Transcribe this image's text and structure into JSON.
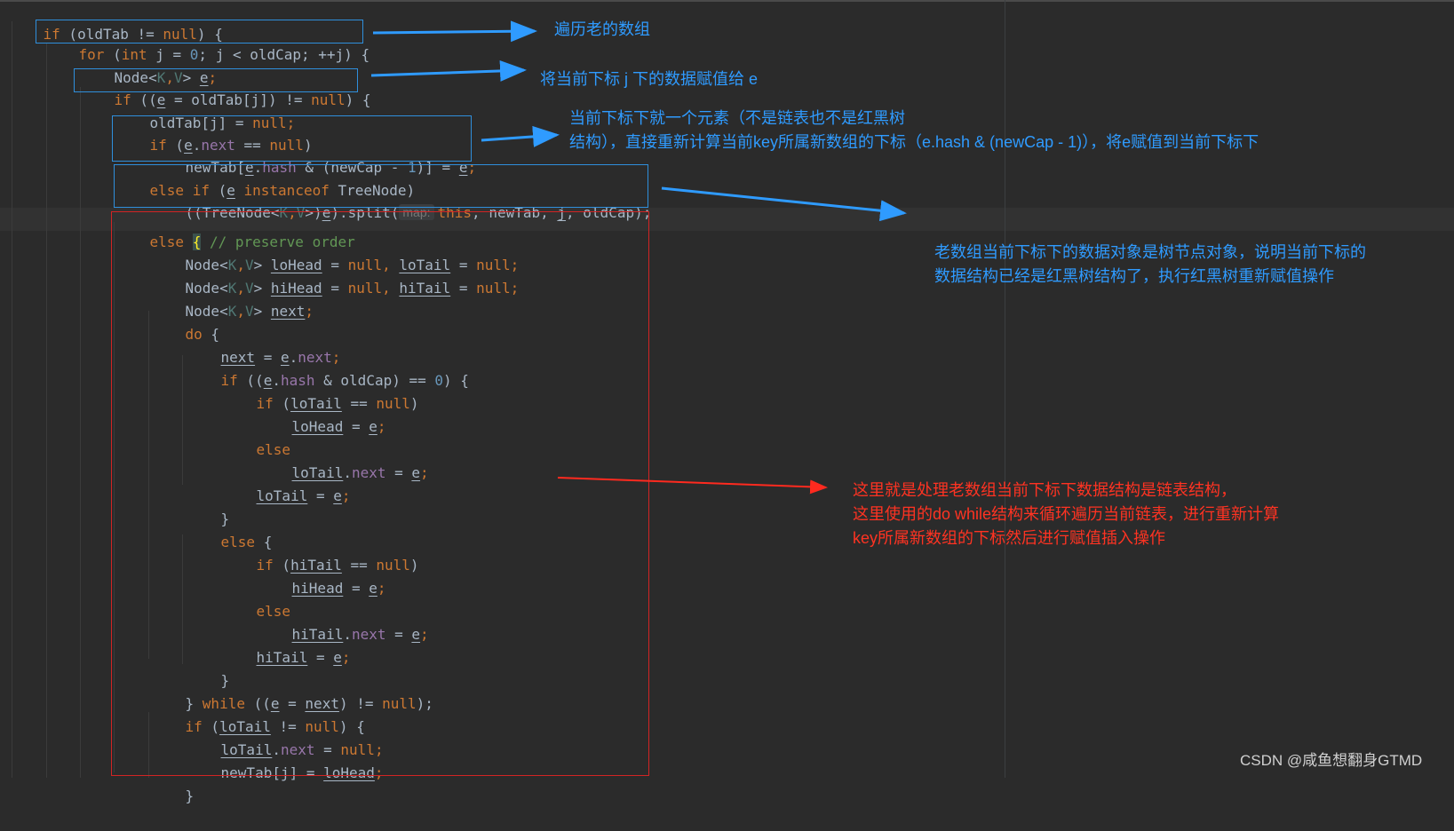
{
  "colors": {
    "background": "#2b2b2b",
    "keyword": "#cc7832",
    "number": "#6897bb",
    "field": "#9876aa",
    "comment": "#629755",
    "annotation_blue": "#2f9bff",
    "annotation_red": "#ff3322"
  },
  "code": {
    "l1": {
      "a": "if",
      "b": " (oldTab != ",
      "c": "null",
      "d": ") {"
    },
    "l2": {
      "a": "for",
      "b": " (",
      "c": "int",
      "d": " j = ",
      "e": "0",
      "f": "; j < oldCap; ++j) {"
    },
    "l3": {
      "a": "Node<",
      "b": "K",
      "c": ",",
      "d": "V",
      "e": "> ",
      "f": "e",
      "g": ";"
    },
    "l4": {
      "a": "if",
      "b": " ((",
      "c": "e",
      "d": " = oldTab[j]) != ",
      "e": "null",
      "f": ") {"
    },
    "l5": {
      "a": "oldTab[j] = ",
      "b": "null",
      "c": ";"
    },
    "l6": {
      "a": "if",
      "b": " (",
      "c": "e",
      "d": ".",
      "e": "next",
      "f": " == ",
      "g": "null",
      "h": ")"
    },
    "l7": {
      "a": "newTab[",
      "b": "e",
      "c": ".",
      "d": "hash",
      "e": " & (newCap - ",
      "f": "1",
      "g": ")] = ",
      "h": "e",
      "i": ";"
    },
    "l8": {
      "a": "else if",
      "b": " (",
      "c": "e",
      "d": " ",
      "e": "instanceof",
      "f": " TreeNode)"
    },
    "l9": {
      "a": "((TreeNode<",
      "b": "K",
      "c": ",",
      "d": "V",
      "e": ">)",
      "f": "e",
      "g": ").split(",
      "hint": "map:",
      "h": "this",
      "i": ", newTab, ",
      "j": "j",
      "k": ", oldCap);"
    },
    "l10": {
      "a": "else",
      "b": " ",
      "c": "{",
      "d": " // preserve order"
    },
    "l11": {
      "a": "Node<",
      "b": "K",
      "c": ",",
      "d": "V",
      "e": "> ",
      "f": "loHead",
      "g": " = ",
      "h": "null",
      "i": ", ",
      "j": "loTail",
      "k": " = ",
      "l": "null",
      "m": ";"
    },
    "l12": {
      "a": "Node<",
      "b": "K",
      "c": ",",
      "d": "V",
      "e": "> ",
      "f": "hiHead",
      "g": " = ",
      "h": "null",
      "i": ", ",
      "j": "hiTail",
      "k": " = ",
      "l": "null",
      "m": ";"
    },
    "l13": {
      "a": "Node<",
      "b": "K",
      "c": ",",
      "d": "V",
      "e": "> ",
      "f": "next",
      "g": ";"
    },
    "l14": {
      "a": "do",
      "b": " {"
    },
    "l15": {
      "a": "next",
      "b": " = ",
      "c": "e",
      "d": ".",
      "e": "next",
      "f": ";"
    },
    "l16": {
      "a": "if",
      "b": " ((",
      "c": "e",
      "d": ".",
      "e": "hash",
      "f": " & oldCap) == ",
      "g": "0",
      "h": ") {"
    },
    "l17": {
      "a": "if",
      "b": " (",
      "c": "loTail",
      "d": " == ",
      "e": "null",
      "f": ")"
    },
    "l18": {
      "a": "loHead",
      "b": " = ",
      "c": "e",
      "d": ";"
    },
    "l19": {
      "a": "else"
    },
    "l20": {
      "a": "loTail",
      "b": ".",
      "c": "next",
      "d": " = ",
      "e": "e",
      "f": ";"
    },
    "l21": {
      "a": "loTail",
      "b": " = ",
      "c": "e",
      "d": ";"
    },
    "l22": {
      "a": "}"
    },
    "l23": {
      "a": "else",
      "b": " {"
    },
    "l24": {
      "a": "if",
      "b": " (",
      "c": "hiTail",
      "d": " == ",
      "e": "null",
      "f": ")"
    },
    "l25": {
      "a": "hiHead",
      "b": " = ",
      "c": "e",
      "d": ";"
    },
    "l26": {
      "a": "else"
    },
    "l27": {
      "a": "hiTail",
      "b": ".",
      "c": "next",
      "d": " = ",
      "e": "e",
      "f": ";"
    },
    "l28": {
      "a": "hiTail",
      "b": " = ",
      "c": "e",
      "d": ";"
    },
    "l29": {
      "a": "}"
    },
    "l30": {
      "a": "} ",
      "b": "while",
      "c": " ((",
      "d": "e",
      "e": " = ",
      "f": "next",
      "g": ") != ",
      "h": "null",
      "i": ");"
    },
    "l31": {
      "a": "if",
      "b": " (",
      "c": "loTail",
      "d": " != ",
      "e": "null",
      "f": ") {"
    },
    "l32": {
      "a": "loTail",
      "b": ".",
      "c": "next",
      "d": " = ",
      "e": "null",
      "f": ";"
    },
    "l33": {
      "a": "newTab[j] = ",
      "b": "loHead",
      "c": ";"
    },
    "l34": {
      "a": "}"
    }
  },
  "annotations": {
    "traverse": "遍历老的数组",
    "assign_e": "将当前下标 j 下的数据赋值给 e",
    "single_element": "当前下标下就一个元素（不是链表也不是红黑树\n结构），直接重新计算当前key所属新数组的下标（e.hash & (newCap - 1)），将e赋值到当前下标下",
    "tree_node": "老数组当前下标下的数据对象是树节点对象，说明当前下标的\n数据结构已经是红黑树结构了，执行红黑树重新赋值操作",
    "linked_list": "这里就是处理老数组当前下标下数据结构是链表结构，\n这里使用的do while结构来循环遍历当前链表，进行重新计算\nkey所属新数组的下标然后进行赋值插入操作"
  },
  "watermark": "CSDN @咸鱼想翻身GTMD"
}
